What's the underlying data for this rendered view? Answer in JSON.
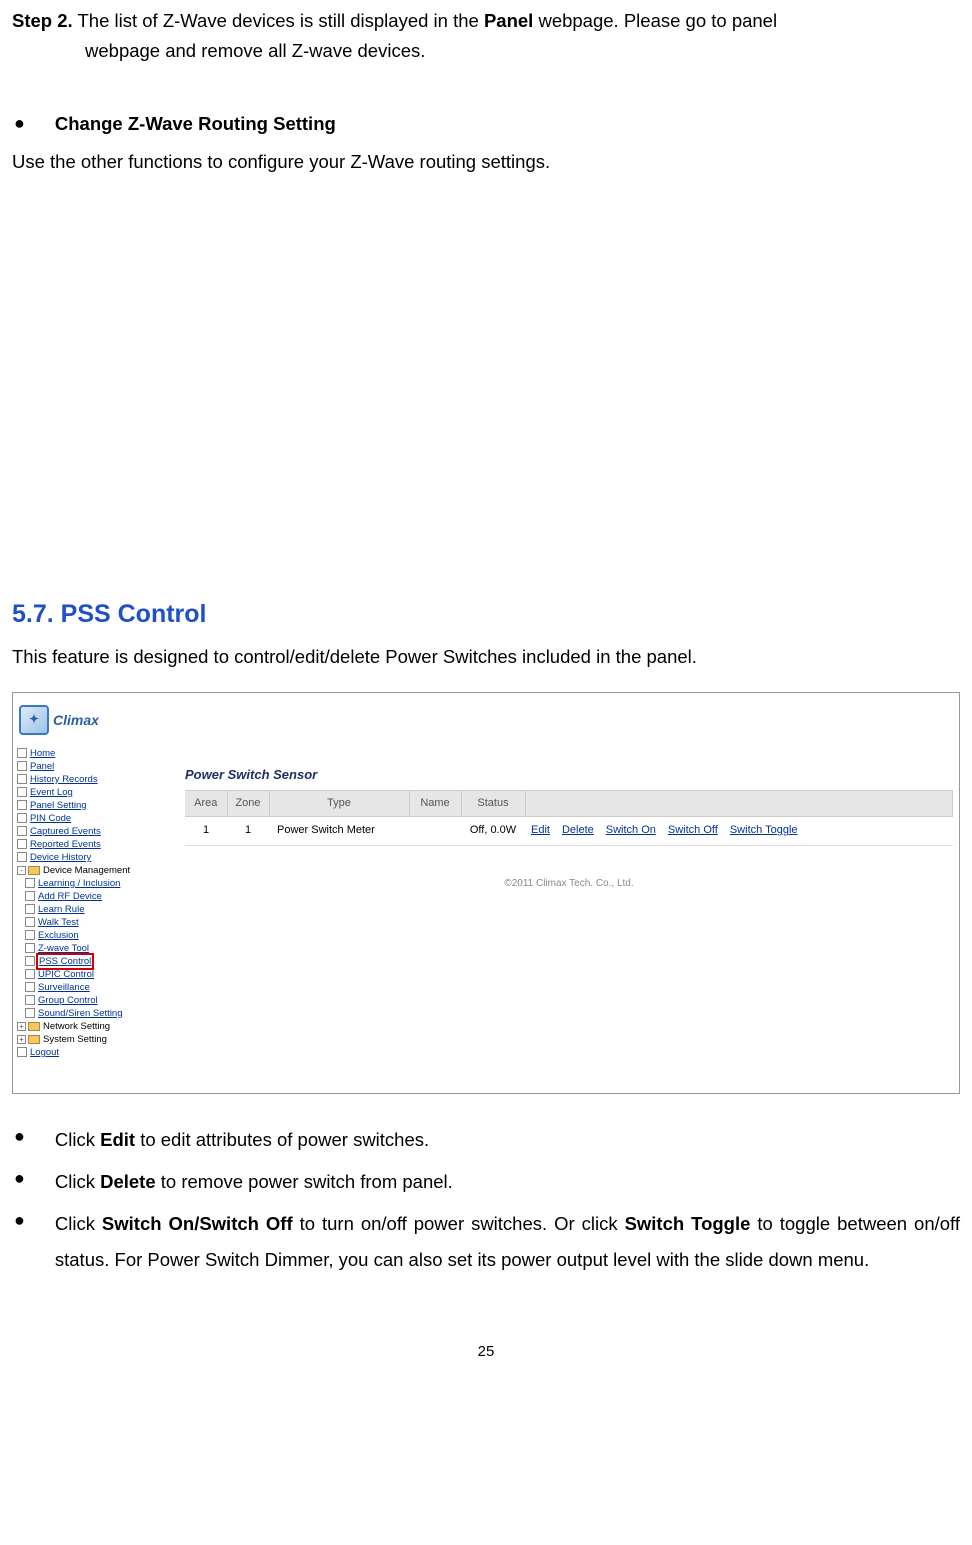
{
  "step2": {
    "label": "Step 2.",
    "line1": " The list of Z-Wave devices is still displayed in the ",
    "bold1": "Panel",
    "line1b": " webpage. Please go to panel",
    "line2": "webpage and remove all Z-wave devices."
  },
  "changeSetting": {
    "title": "Change Z-Wave Routing Setting",
    "body": "Use the other functions to configure your Z-Wave routing settings."
  },
  "section": {
    "heading": "5.7. PSS Control",
    "body": "This feature is designed to control/edit/delete Power Switches included in the panel."
  },
  "screenshot": {
    "logoText": "Climax",
    "tree": [
      {
        "t": "link",
        "label": "Home",
        "indent": 0,
        "icon": "doc"
      },
      {
        "t": "link",
        "label": "Panel",
        "indent": 0,
        "icon": "doc"
      },
      {
        "t": "link",
        "label": "History Records",
        "indent": 0,
        "icon": "doc"
      },
      {
        "t": "link",
        "label": "Event Log",
        "indent": 0,
        "icon": "doc"
      },
      {
        "t": "link",
        "label": "Panel Setting",
        "indent": 0,
        "icon": "doc"
      },
      {
        "t": "link",
        "label": "PIN Code",
        "indent": 0,
        "icon": "doc"
      },
      {
        "t": "link",
        "label": "Captured Events",
        "indent": 0,
        "icon": "doc"
      },
      {
        "t": "link",
        "label": "Reported Events",
        "indent": 0,
        "icon": "doc"
      },
      {
        "t": "link",
        "label": "Device History",
        "indent": 0,
        "icon": "doc"
      },
      {
        "t": "folder",
        "label": "Device Management",
        "indent": 0,
        "icon": "folder",
        "exp": "-"
      },
      {
        "t": "link",
        "label": "Learning / Inclusion",
        "indent": 1,
        "icon": "doc"
      },
      {
        "t": "link",
        "label": "Add RF Device",
        "indent": 1,
        "icon": "doc"
      },
      {
        "t": "link",
        "label": "Learn Rule",
        "indent": 1,
        "icon": "doc"
      },
      {
        "t": "link",
        "label": "Walk Test",
        "indent": 1,
        "icon": "doc"
      },
      {
        "t": "link",
        "label": "Exclusion",
        "indent": 1,
        "icon": "doc"
      },
      {
        "t": "link",
        "label": "Z-wave Tool",
        "indent": 1,
        "icon": "doc"
      },
      {
        "t": "link",
        "label": "PSS Control",
        "indent": 1,
        "icon": "doc",
        "highlight": true
      },
      {
        "t": "link",
        "label": "UPIC Control",
        "indent": 1,
        "icon": "doc"
      },
      {
        "t": "link",
        "label": "Surveillance",
        "indent": 1,
        "icon": "doc"
      },
      {
        "t": "link",
        "label": "Group Control",
        "indent": 1,
        "icon": "doc"
      },
      {
        "t": "link",
        "label": "Sound/Siren Setting",
        "indent": 1,
        "icon": "doc"
      },
      {
        "t": "folder",
        "label": "Network Setting",
        "indent": 0,
        "icon": "folder",
        "exp": "+"
      },
      {
        "t": "folder",
        "label": "System Setting",
        "indent": 0,
        "icon": "folder",
        "exp": "+"
      },
      {
        "t": "link",
        "label": "Logout",
        "indent": 0,
        "icon": "doc"
      }
    ],
    "panelTitle": "Power Switch Sensor",
    "columns": [
      "Area",
      "Zone",
      "Type",
      "Name",
      "Status",
      ""
    ],
    "row": {
      "area": "1",
      "zone": "1",
      "type": "Power Switch Meter",
      "name": "",
      "status": "Off, 0.0W",
      "actions": [
        "Edit",
        "Delete",
        "Switch On",
        "Switch Off",
        "Switch Toggle"
      ]
    },
    "copyright": "©2011 Climax Tech. Co., Ltd."
  },
  "bullets": {
    "b1a": "Click ",
    "b1b": "Edit",
    "b1c": " to edit attributes of power switches.",
    "b2a": "Click ",
    "b2b": "Delete",
    "b2c": " to remove power switch from panel.",
    "b3a": "Click ",
    "b3b": "Switch On/Switch Off",
    "b3c": " to turn on/off power switches. Or click ",
    "b3d": "Switch Toggle",
    "b3e": " to toggle between on/off status. For Power Switch Dimmer, you can also set its power output level with the slide down menu."
  },
  "pageNum": "25"
}
